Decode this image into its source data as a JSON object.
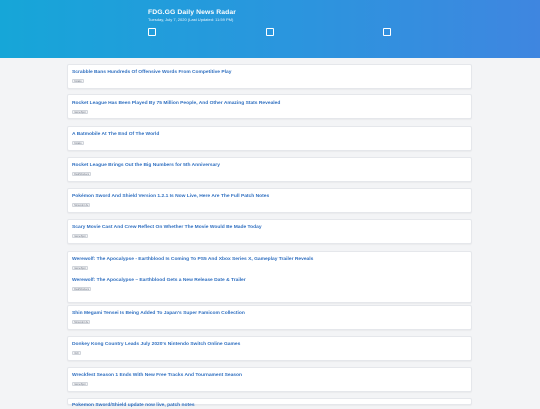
{
  "header": {
    "title": "FDG.GG Daily News Radar",
    "date": "Tuesday, July 7, 2020 (Last Updated: 11:59 PM)"
  },
  "articles": [
    {
      "title": "Scrabble Bans Hundreds Of Offensive Words From Competitive Play",
      "source": "Kotaku"
    },
    {
      "title": "Rocket League Has Been Played By 75 Million People, And Other Amazing Stats Revealed",
      "source": "GameSpot"
    },
    {
      "title": "A Batmobile At The End Of The World",
      "source": "Kotaku"
    },
    {
      "title": "Rocket League Brings Out the Big Numbers for 5th Anniversary",
      "source": "DualShockers"
    },
    {
      "title": "Pokémon Sword And Shield Version 1.2.1 Is Now Live, Here Are The Full Patch Notes",
      "source": "Nintendo Life"
    },
    {
      "title": "Scary Movie Cast And Crew Reflect On Whether The Movie Would Be Made Today",
      "source": "GameSpot"
    },
    {
      "title": "Werewolf: The Apocalypse - Earthblood Is Coming To PS5 And Xbox Series X, Gameplay Trailer Reveals",
      "source": "GameSpot"
    },
    {
      "title": "Werewolf: The Apocalypse – Earthblood Gets a New Release Date & Trailer",
      "source": "DualShockers"
    },
    {
      "title": "Shin Megami Tensei Is Being Added To Japan's Super Famicom Collection",
      "source": "Nintendo Life"
    },
    {
      "title": "Donkey Kong Country Leads July 2020's Nintendo Switch Online Games",
      "source": "IGN"
    },
    {
      "title": "Wreckfest Season 1 Ends With New Free Tracks And Tournament Season",
      "source": "GameSpot"
    },
    {
      "title": "Pokemon Sword/Shield update now live, patch notes",
      "source": ""
    }
  ]
}
